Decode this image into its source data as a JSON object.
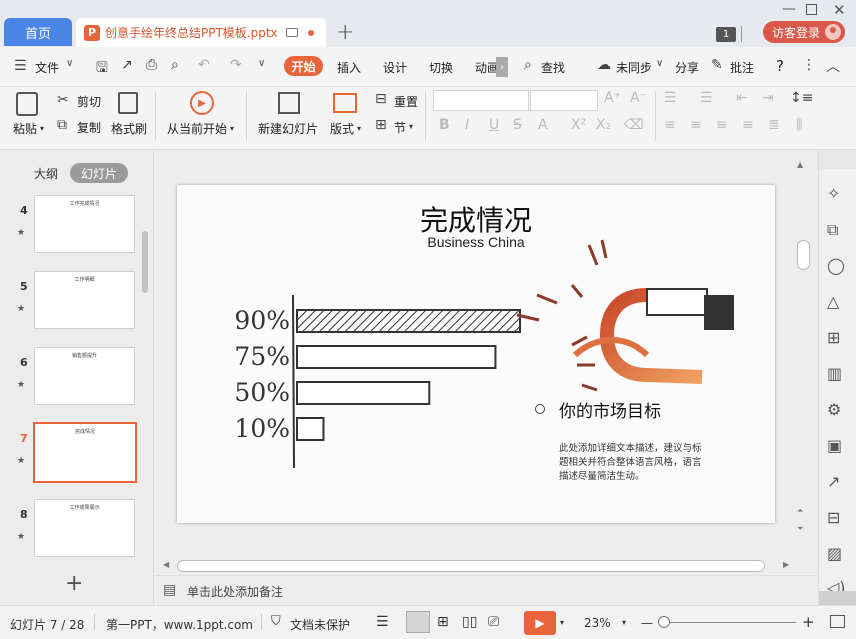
{
  "window": {
    "home_tab": "首页",
    "doc_tab": "创意手绘年终总结PPT模板.pptx",
    "badge": "1",
    "login": "访客登录"
  },
  "menu": {
    "file": "文件",
    "tabs": [
      "开始",
      "插入",
      "设计",
      "切换",
      "动画"
    ],
    "search": "查找",
    "sync": "未同步",
    "share": "分享",
    "annotate": "批注",
    "help": "?"
  },
  "ribbon": {
    "paste": "粘贴",
    "cut": "剪切",
    "copy": "复制",
    "format_painter": "格式刷",
    "from_current": "从当前开始",
    "new_slide": "新建幻灯片",
    "layout": "版式",
    "reset": "重置",
    "section": "节"
  },
  "left_panel": {
    "outline_tab": "大纲",
    "slides_tab": "幻灯片",
    "slides": [
      {
        "num": "4",
        "title": "工作完成情况"
      },
      {
        "num": "5",
        "title": "工作明细"
      },
      {
        "num": "6",
        "title": "销售额提升"
      },
      {
        "num": "7",
        "title": "完成情况"
      },
      {
        "num": "8",
        "title": "工作成果展示"
      }
    ],
    "add_label": "+"
  },
  "slide": {
    "title": "完成情况",
    "subtitle": "Business China",
    "target_heading": "你的市场目标",
    "body": "此处添加详细文本描述，建议与标题相关并符合整体语言风格，语言描述尽量简洁生动。",
    "body_lines": [
      "此处添加详细文本描述，建议与标",
      "题相关并符合整体语言风格，语言",
      "描述尽量简洁生动。"
    ]
  },
  "chart_data": {
    "type": "bar",
    "orientation": "horizontal",
    "categories": [
      "90%",
      "75%",
      "50%",
      "10%"
    ],
    "values": [
      90,
      75,
      50,
      10
    ],
    "xlim": [
      0,
      100
    ]
  },
  "notes_placeholder": "单击此处添加备注",
  "status": {
    "slide_info": "幻灯片 7 / 28",
    "source": "第一PPT，www.1ppt.com",
    "protect": "文档未保护",
    "zoom": "23%",
    "minus": "—",
    "plus": "+"
  }
}
